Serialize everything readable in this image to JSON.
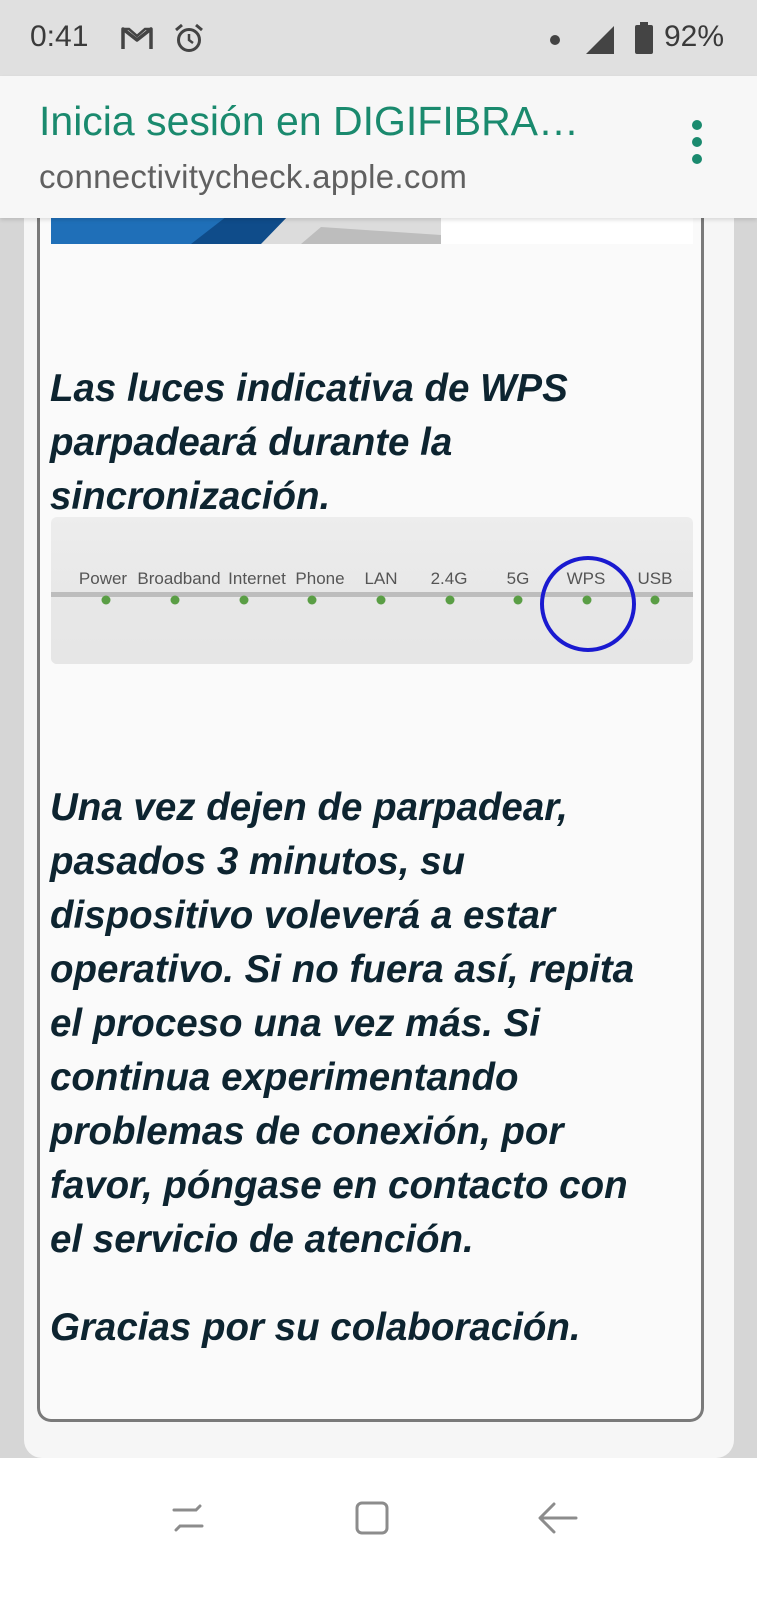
{
  "status_bar": {
    "time": "0:41",
    "battery": "92%",
    "icons": [
      "gmail-icon",
      "alarm-icon",
      "dot-icon",
      "cell-signal-icon",
      "battery-icon"
    ]
  },
  "browser": {
    "title": "Inicia sesión en DIGIFIBRA…",
    "url": "connectivitycheck.apple.com",
    "accent_color": "#1a8a6e"
  },
  "content": {
    "wps_heading": [
      "Las luces indicativa de WPS",
      "parpadeará durante la",
      "sincronización."
    ],
    "leds": [
      "Power",
      "Broadband",
      "Internet",
      "Phone",
      "LAN",
      "2.4G",
      "5G",
      "WPS",
      "USB"
    ],
    "highlighted_led": "WPS",
    "body_text": [
      "Una vez dejen de parpadear,",
      "pasados 3 minutos, su",
      "dispositivo voleverá a estar",
      "operativo. Si no fuera así, repita",
      "el proceso una vez más. Si",
      "continua experimentando",
      "problemas de conexión, por",
      "favor, póngase en contacto con",
      "el servicio de atención."
    ],
    "thanks": "Gracias por su colaboración."
  },
  "nav": {
    "buttons": [
      "recent-apps-icon",
      "home-icon",
      "back-icon"
    ]
  }
}
